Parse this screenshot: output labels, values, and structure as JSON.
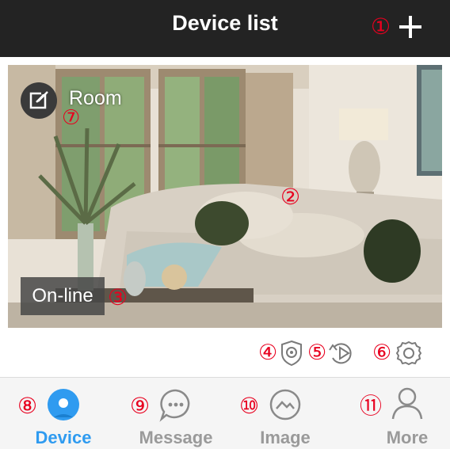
{
  "header": {
    "title": "Device list",
    "add_icon": "plus-icon",
    "marker": "①"
  },
  "device_card": {
    "room_label": "Room",
    "edit_icon": "edit-icon",
    "status": "On-line",
    "markers": {
      "preview": "②",
      "status": "③",
      "room": "⑦"
    }
  },
  "actions": [
    {
      "icon": "shield-camera-icon",
      "marker": "④"
    },
    {
      "icon": "playback-icon",
      "marker": "⑤"
    },
    {
      "icon": "settings-icon",
      "marker": "⑥"
    }
  ],
  "tabs": [
    {
      "label": "Device",
      "icon": "device-icon",
      "marker": "⑧",
      "active": true
    },
    {
      "label": "Message",
      "icon": "message-icon",
      "marker": "⑨",
      "active": false
    },
    {
      "label": "Image",
      "icon": "image-icon",
      "marker": "⑩",
      "active": false
    },
    {
      "label": "More",
      "icon": "person-icon",
      "marker": "⑪",
      "active": false
    }
  ],
  "colors": {
    "header_bg": "#232323",
    "marker": "#e8001f",
    "active_tab": "#2f9bf0",
    "inactive_tab": "#9a9a9a",
    "icon_gray": "#7a7a7a"
  }
}
